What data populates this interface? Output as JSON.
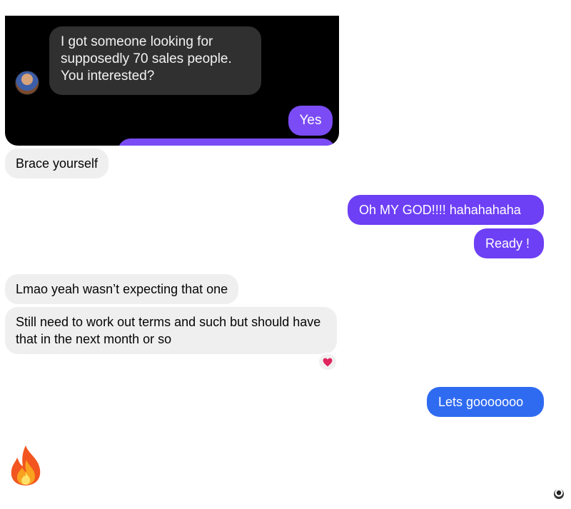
{
  "quoted_screenshot": {
    "incoming_message": "I got someone looking for supposedly 70 sales people. You interested?",
    "outgoing_message": "Yes"
  },
  "messages": [
    {
      "text": "Brace yourself"
    },
    {
      "text": "Oh MY GOD!!!! hahahahaha"
    },
    {
      "text": "Ready !"
    },
    {
      "text": "Lmao yeah wasn’t expecting that one"
    },
    {
      "text": "Still need to work out terms and such but should have that in the next month or so"
    },
    {
      "text": "Lets gooooooo"
    }
  ],
  "reaction": {
    "icon": "heart-icon",
    "color": "#e0245e"
  },
  "colors": {
    "outgoing_violet": "#6d3ff5",
    "outgoing_blue": "#2f6bf1",
    "incoming_gray": "#efefef"
  },
  "icons": {
    "sticker": "fire-icon",
    "seen_indicator": "seen-avatar"
  }
}
